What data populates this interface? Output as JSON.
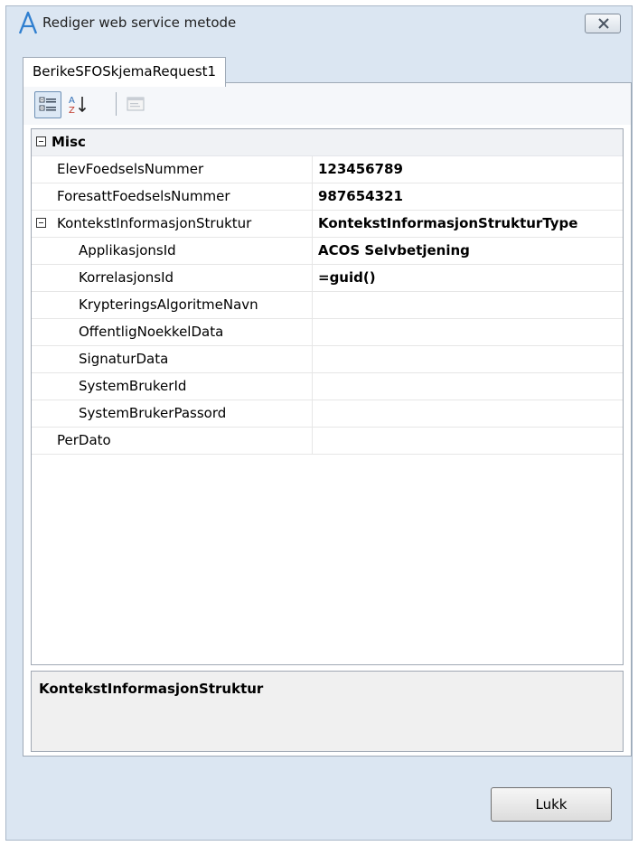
{
  "window": {
    "title": "Rediger web service metode",
    "app_icon": "acos-logo-icon",
    "close_icon": "close-icon"
  },
  "tabs": [
    {
      "label": "BerikeSFOSkjemaRequest1",
      "selected": true
    }
  ],
  "toolbar": {
    "buttons": [
      {
        "icon": "categorized-icon",
        "active": true
      },
      {
        "icon": "alphabetical-sort-icon",
        "active": false
      },
      {
        "icon": "property-pages-icon",
        "active": false,
        "disabled": true
      }
    ]
  },
  "property_grid": {
    "rows": [
      {
        "type": "category",
        "name": "Misc",
        "expanded": true
      },
      {
        "type": "property",
        "name": "ElevFoedselsNummer",
        "value": "123456789"
      },
      {
        "type": "property",
        "name": "ForesattFoedselsNummer",
        "value": "987654321"
      },
      {
        "type": "group",
        "name": "KontekstInformasjonStruktur",
        "value": "KontekstInformasjonStrukturType",
        "expanded": true
      },
      {
        "type": "child",
        "name": "ApplikasjonsId",
        "value": "ACOS Selvbetjening"
      },
      {
        "type": "child",
        "name": "KorrelasjonsId",
        "value": "=guid()"
      },
      {
        "type": "child",
        "name": "KrypteringsAlgoritmeNavn",
        "value": ""
      },
      {
        "type": "child",
        "name": "OffentligNoekkelData",
        "value": ""
      },
      {
        "type": "child",
        "name": "SignaturData",
        "value": ""
      },
      {
        "type": "child",
        "name": "SystemBrukerId",
        "value": ""
      },
      {
        "type": "child",
        "name": "SystemBrukerPassord",
        "value": ""
      },
      {
        "type": "property",
        "name": "PerDato",
        "value": ""
      }
    ]
  },
  "description": {
    "title": "KontekstInformasjonStruktur"
  },
  "footer": {
    "close_label": "Lukk"
  },
  "colors": {
    "window_bg": "#dbe6f2",
    "accent_logo": "#2f7fd0"
  }
}
